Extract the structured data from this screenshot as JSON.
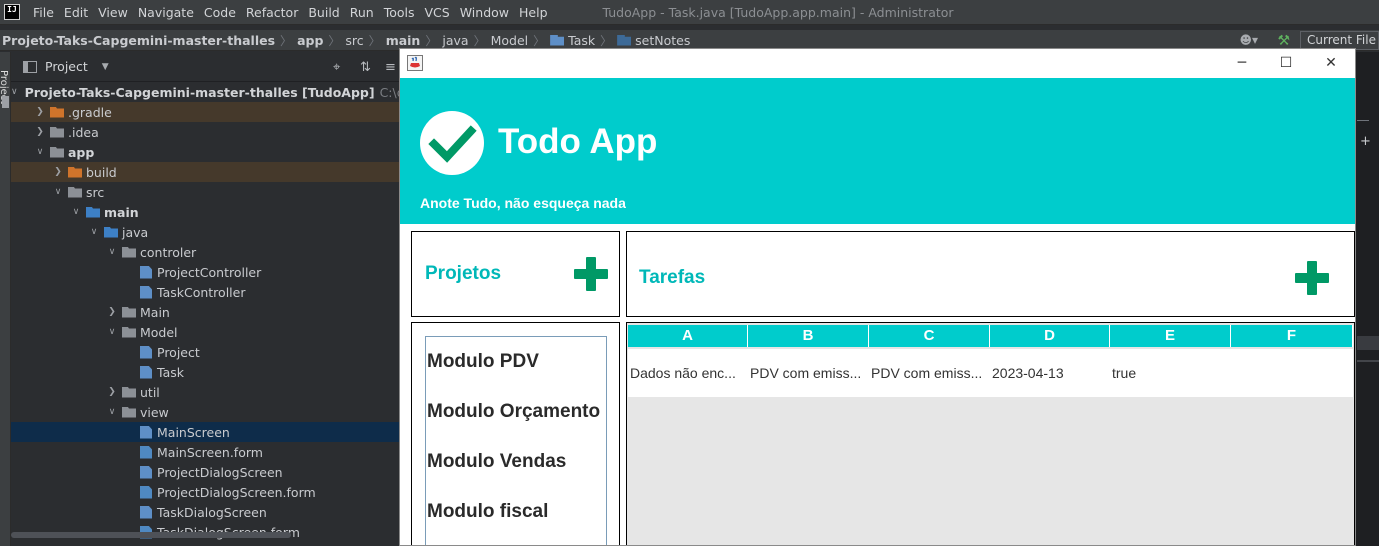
{
  "ide": {
    "logo": "IJ",
    "menu": [
      "File",
      "Edit",
      "View",
      "Navigate",
      "Code",
      "Refactor",
      "Build",
      "Run",
      "Tools",
      "VCS",
      "Window",
      "Help"
    ],
    "window_title": "TudoApp - Task.java [TudoApp.app.main] - Administrator",
    "breadcrumb": [
      "Projeto-Taks-Capgemini-master-thalles",
      "app",
      "src",
      "main",
      "java",
      "Model",
      "Task",
      "setNotes"
    ],
    "run_config": "Current File",
    "stripe_label": "Project"
  },
  "project_panel": {
    "title": "Project",
    "tree": [
      {
        "label": "Projeto-Taks-Capgemini-master-thalles [TudoApp]",
        "path": "C:\\dev\\works",
        "icon": "module-folder-icon",
        "indent": 0,
        "arrow": "down",
        "bold": true
      },
      {
        "label": ".gradle",
        "icon": "excluded-folder-icon",
        "indent": 1,
        "arrow": "right",
        "excluded": true
      },
      {
        "label": ".idea",
        "icon": "folder-icon",
        "indent": 1,
        "arrow": "right"
      },
      {
        "label": "app",
        "icon": "module-folder-icon",
        "indent": 1,
        "arrow": "down",
        "bold": true
      },
      {
        "label": "build",
        "icon": "excluded-folder-icon",
        "indent": 2,
        "arrow": "right",
        "excluded": true
      },
      {
        "label": "src",
        "icon": "folder-icon",
        "indent": 2,
        "arrow": "down"
      },
      {
        "label": "main",
        "icon": "source-folder-icon",
        "indent": 3,
        "arrow": "down",
        "bold": true
      },
      {
        "label": "java",
        "icon": "source-root-icon",
        "indent": 4,
        "arrow": "down"
      },
      {
        "label": "controler",
        "icon": "package-icon",
        "indent": 5,
        "arrow": "down"
      },
      {
        "label": "ProjectController",
        "icon": "java-class-icon",
        "indent": 6
      },
      {
        "label": "TaskController",
        "icon": "java-class-icon",
        "indent": 6
      },
      {
        "label": "Main",
        "icon": "package-icon",
        "indent": 5,
        "arrow": "right"
      },
      {
        "label": "Model",
        "icon": "package-icon",
        "indent": 5,
        "arrow": "down"
      },
      {
        "label": "Project",
        "icon": "java-class-icon",
        "indent": 6
      },
      {
        "label": "Task",
        "icon": "java-class-icon",
        "indent": 6
      },
      {
        "label": "util",
        "icon": "package-icon",
        "indent": 5,
        "arrow": "right"
      },
      {
        "label": "view",
        "icon": "package-icon",
        "indent": 5,
        "arrow": "down"
      },
      {
        "label": "MainScreen",
        "icon": "java-form-class-icon",
        "indent": 6,
        "selected": true
      },
      {
        "label": "MainScreen.form",
        "icon": "form-file-icon",
        "indent": 6
      },
      {
        "label": "ProjectDialogScreen",
        "icon": "java-form-class-icon",
        "indent": 6
      },
      {
        "label": "ProjectDialogScreen.form",
        "icon": "form-file-icon",
        "indent": 6
      },
      {
        "label": "TaskDialogScreen",
        "icon": "java-form-class-icon",
        "indent": 6
      },
      {
        "label": "TaskDialogScreen.form",
        "icon": "form-file-icon",
        "indent": 6
      }
    ]
  },
  "todo_app": {
    "window_controls": [
      "─",
      "☐",
      "✕"
    ],
    "title": "Todo App",
    "subtitle": "Anote Tudo, não esqueça nada",
    "colors": {
      "accent": "#00CCCC",
      "add": "#009966",
      "title_text": "#00B8B8"
    },
    "projects": {
      "title": "Projetos",
      "items": [
        "Modulo PDV",
        "Modulo Orçamento",
        "Modulo Vendas",
        "Modulo fiscal"
      ]
    },
    "tasks": {
      "title": "Tarefas",
      "columns": [
        "A",
        "B",
        "C",
        "D",
        "E",
        "F"
      ],
      "rows": [
        [
          "Dados não enc...",
          "PDV com emiss...",
          "PDV com emiss...",
          "2023-04-13",
          "true",
          ""
        ]
      ]
    }
  }
}
